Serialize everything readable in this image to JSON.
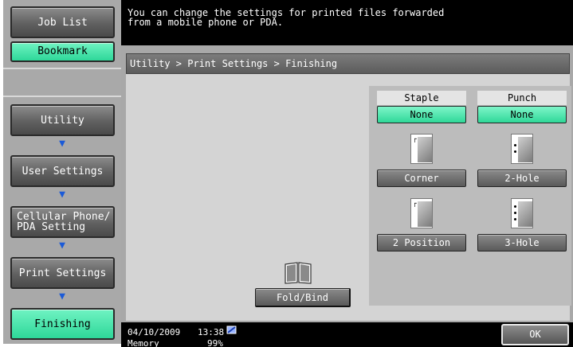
{
  "sidebar": {
    "job_list": "Job List",
    "bookmark": "Bookmark",
    "items": [
      {
        "label": "Utility"
      },
      {
        "label": "User Settings"
      },
      {
        "label": "Cellular Phone/\nPDA Setting"
      },
      {
        "label": "Print Settings"
      },
      {
        "label": "Finishing"
      }
    ]
  },
  "message": {
    "line1": "You can change the settings for printed files forwarded",
    "line2": "from a mobile phone or PDA."
  },
  "breadcrumb": "Utility > Print Settings > Finishing",
  "staple": {
    "label": "Staple",
    "none": "None",
    "corner": "Corner",
    "two_position": "2 Position"
  },
  "punch": {
    "label": "Punch",
    "none": "None",
    "two_hole": "2-Hole",
    "three_hole": "3-Hole"
  },
  "fold_bind": "Fold/Bind",
  "status": {
    "date": "04/10/2009",
    "time": "13:38",
    "memory_label": "Memory",
    "memory_value": "99%"
  },
  "ok": "OK",
  "colors": {
    "selected": "#2fd898",
    "arrow": "#1a5ad8"
  }
}
